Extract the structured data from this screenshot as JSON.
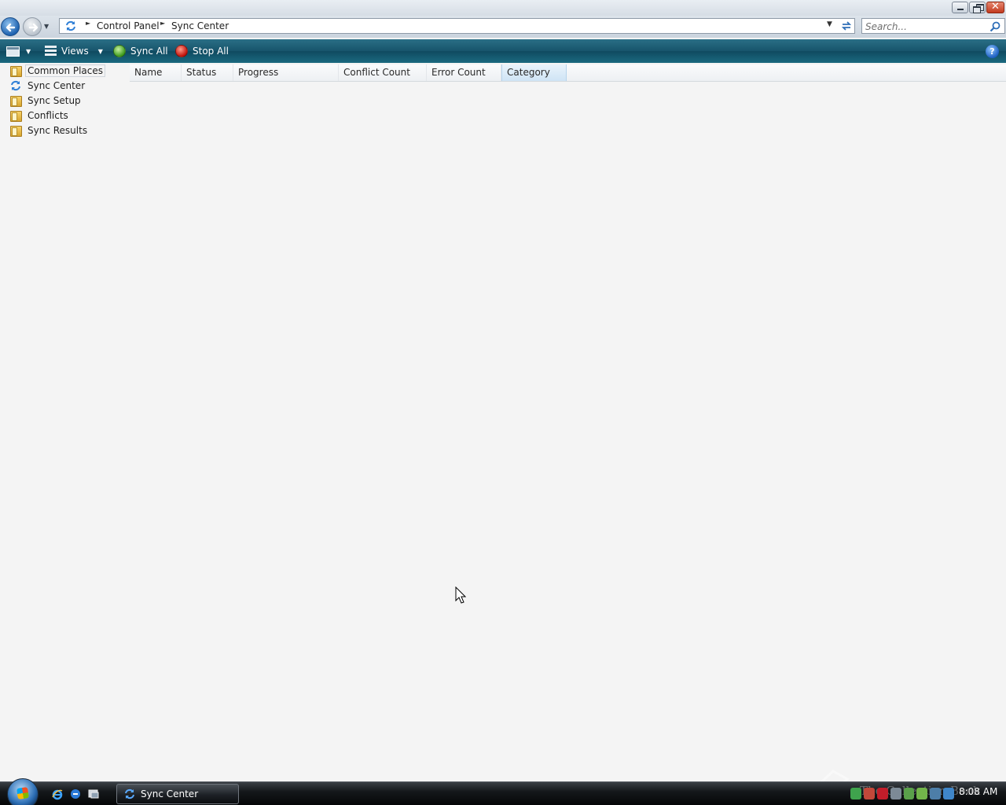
{
  "window": {
    "title_buttons": [
      "minimize",
      "maximize",
      "close"
    ]
  },
  "navigation": {
    "breadcrumb": [
      "Control Panel",
      "Sync Center"
    ],
    "search_placeholder": "Search..."
  },
  "command_bar": {
    "views_label": "Views",
    "sync_all_label": "Sync All",
    "stop_all_label": "Stop All",
    "help_label": "?"
  },
  "left_nav": {
    "items": [
      {
        "label": "Common Places",
        "icon": "folder-icon"
      },
      {
        "label": "Sync Center",
        "icon": "sync-icon"
      },
      {
        "label": "Sync Setup",
        "icon": "folder-icon"
      },
      {
        "label": "Conflicts",
        "icon": "folder-icon"
      },
      {
        "label": "Sync Results",
        "icon": "folder-icon"
      }
    ]
  },
  "columns": [
    "Name",
    "Status",
    "Progress",
    "Conflict Count",
    "Error Count",
    "Category"
  ],
  "taskbar": {
    "active_window": "Sync Center",
    "clock": "8:08 AM",
    "watermark": "The Collection Book"
  },
  "colors": {
    "command_bar": "#17546b",
    "background": "#f4f4f4",
    "accent_green": "#3d9a1c",
    "accent_red": "#c2130b"
  }
}
